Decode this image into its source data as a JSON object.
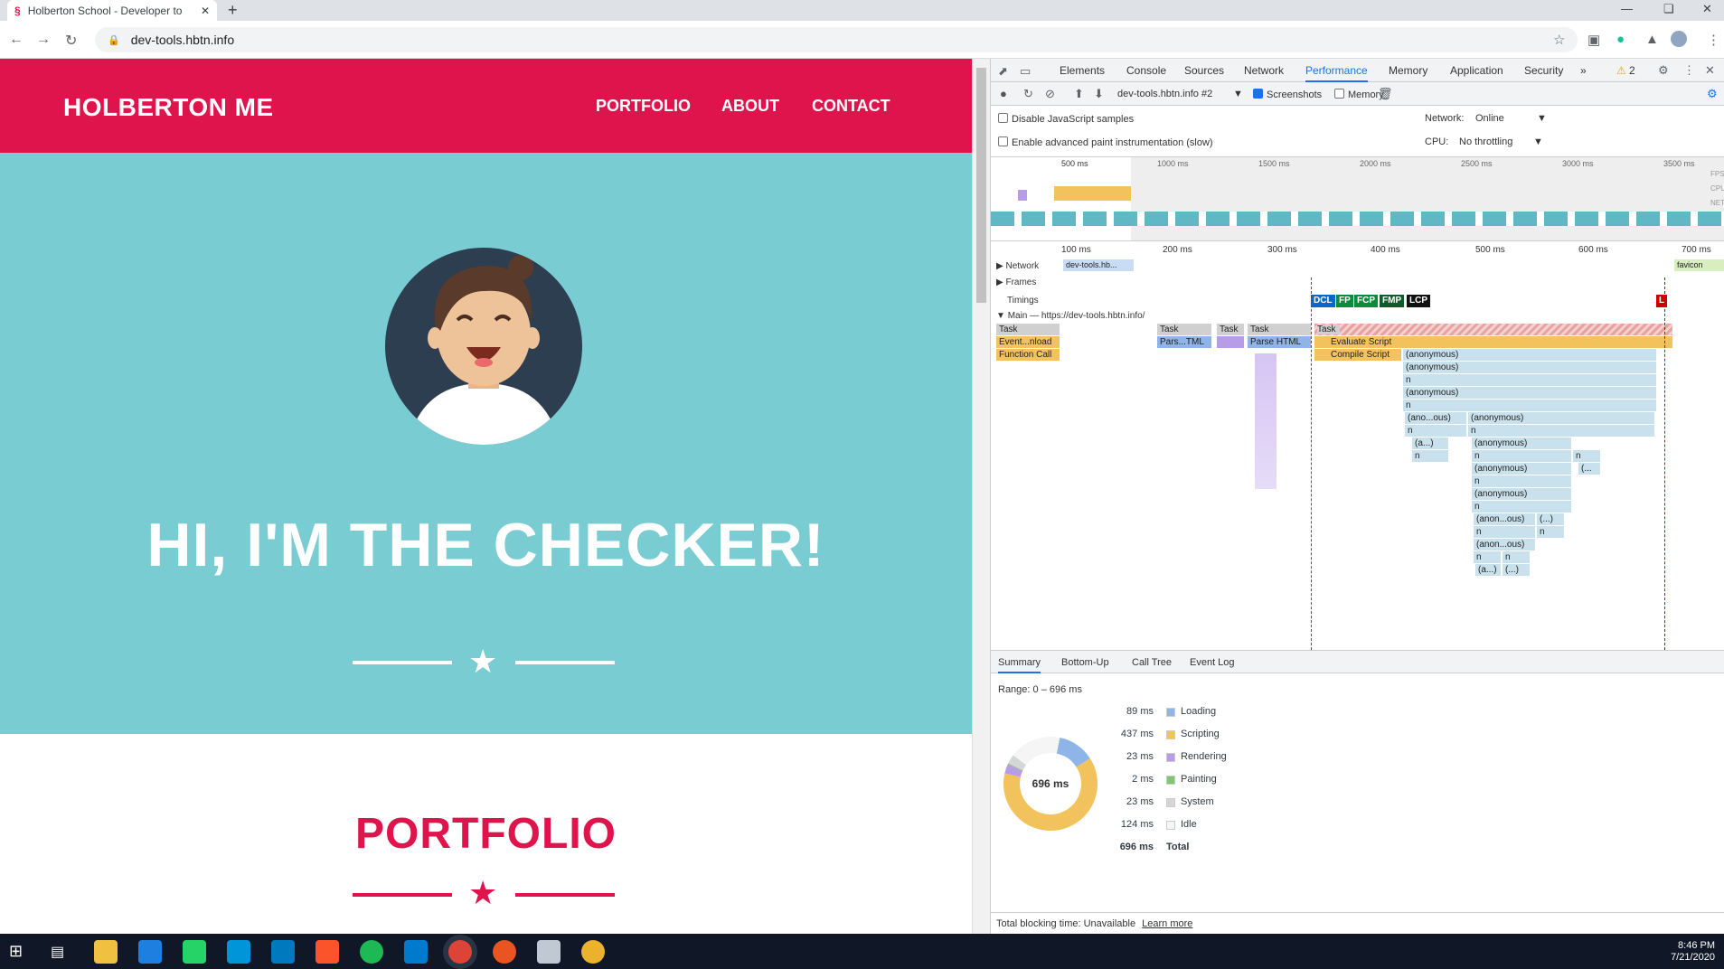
{
  "browser": {
    "tab_title": "Holberton School - Developer to",
    "url": "dev-tools.hbtn.info"
  },
  "site": {
    "brand": "HOLBERTON ME",
    "nav": [
      "PORTFOLIO",
      "ABOUT",
      "CONTACT"
    ],
    "hero_title": "HI, I'M THE CHECKER!",
    "section_title": "PORTFOLIO",
    "colors": {
      "primary": "#e0144c",
      "hero_bg": "#79cdd2"
    }
  },
  "devtools": {
    "tabs": [
      "Elements",
      "Console",
      "Sources",
      "Network",
      "Performance",
      "Memory",
      "Application",
      "Security"
    ],
    "active_tab": "Performance",
    "warnings": "2",
    "recording_select": "dev-tools.hbtn.info #2",
    "screenshots_label": "Screenshots",
    "memory_label": "Memory",
    "disable_js_label": "Disable JavaScript samples",
    "paint_label": "Enable advanced paint instrumentation (slow)",
    "network_label": "Network:",
    "network_value": "Online",
    "cpu_label": "CPU:",
    "cpu_value": "No throttling",
    "overview_ticks": [
      "500 ms",
      "1000 ms",
      "1500 ms",
      "2000 ms",
      "2500 ms",
      "3000 ms",
      "3500 ms"
    ],
    "overview_lanes": [
      "FPS",
      "CPU",
      "NET"
    ],
    "ruler_ticks": [
      "100 ms",
      "200 ms",
      "300 ms",
      "400 ms",
      "500 ms",
      "600 ms",
      "700 ms"
    ],
    "tracks": {
      "network": "Network",
      "network_item": "dev-tools.hb...",
      "favicon_item": "favicon",
      "frames": "Frames",
      "timings": "Timings",
      "main": "Main — https://dev-tools.hbtn.info/"
    },
    "timing_markers": [
      "DCL",
      "FP",
      "FCP",
      "FMP",
      "LCP",
      "L"
    ],
    "flame": {
      "task": "Task",
      "event_load": "Event...nload",
      "function_call": "Function Call",
      "parse_html_short": "Pars...TML",
      "parse_html": "Parse HTML",
      "evaluate_script": "Evaluate Script",
      "compile_script": "Compile Script",
      "anonymous": "(anonymous)",
      "n": "n",
      "ano_ous": "(ano...ous)",
      "anon_ous": "(anon...ous)",
      "a_short": "(a...)",
      "ellipsis": "(...)",
      "dots": "(..."
    },
    "summary_tabs": [
      "Summary",
      "Bottom-Up",
      "Call Tree",
      "Event Log"
    ],
    "range": "Range: 0 – 696 ms",
    "donut_label": "696 ms",
    "summary": [
      {
        "ms": "89 ms",
        "label": "Loading",
        "value": 89,
        "color": "#8fb4e8"
      },
      {
        "ms": "437 ms",
        "label": "Scripting",
        "value": 437,
        "color": "#f2c35c"
      },
      {
        "ms": "23 ms",
        "label": "Rendering",
        "value": 23,
        "color": "#b79ce8"
      },
      {
        "ms": "2 ms",
        "label": "Painting",
        "value": 2,
        "color": "#7fc574"
      },
      {
        "ms": "23 ms",
        "label": "System",
        "value": 23,
        "color": "#d6d6d6"
      },
      {
        "ms": "124 ms",
        "label": "Idle",
        "value": 124,
        "color": "#f5f5f5"
      }
    ],
    "total_ms": "696 ms",
    "total_label": "Total",
    "footer_text": "Total blocking time: Unavailable",
    "learn_more": "Learn more"
  },
  "taskbar": {
    "time": "8:46 PM",
    "date": "7/21/2020"
  }
}
